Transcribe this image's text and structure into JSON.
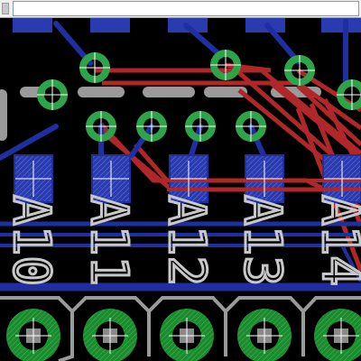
{
  "command_line": {
    "value": "",
    "placeholder": ""
  },
  "colors": {
    "background": "#000000",
    "top_copper": "#b0272a",
    "bottom_copper": "#1f2fa0",
    "via_ring": "#2fa34a",
    "silkscreen": "#c8c8c8",
    "crosshair": "#ffffff"
  },
  "pad_labels": [
    "A10",
    "A11",
    "A12",
    "A13",
    "A14"
  ]
}
